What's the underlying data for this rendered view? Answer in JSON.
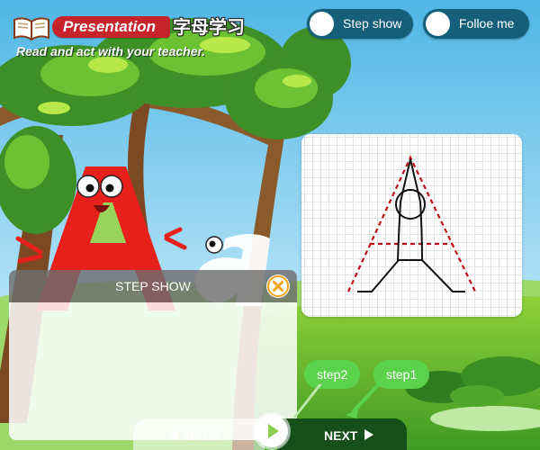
{
  "header": {
    "badge_label": "Presentation",
    "title_cn": "字母学习",
    "subtitle": "Read and act with your teacher."
  },
  "toggles": {
    "step_show": "Step show",
    "follow_me": "Folloe me"
  },
  "step_panel": {
    "title": "STEP SHOW"
  },
  "bubbles": {
    "step2": "step2",
    "step1": "step1"
  },
  "nav": {
    "back": "BACK",
    "next": "NEXT"
  },
  "colors": {
    "badge_red": "#c6232b",
    "toggle_teal": "#155f7a",
    "bubble_green": "#5bd24c",
    "next_dark_green": "#164f1a",
    "close_orange": "#f2a31b",
    "stroke_red_dashed": "#c0121c"
  },
  "icons": {
    "book": "book-icon",
    "close": "close-icon",
    "play": "play-icon",
    "back_arrow": "left-triangle-icon",
    "next_arrow": "right-triangle-icon"
  }
}
